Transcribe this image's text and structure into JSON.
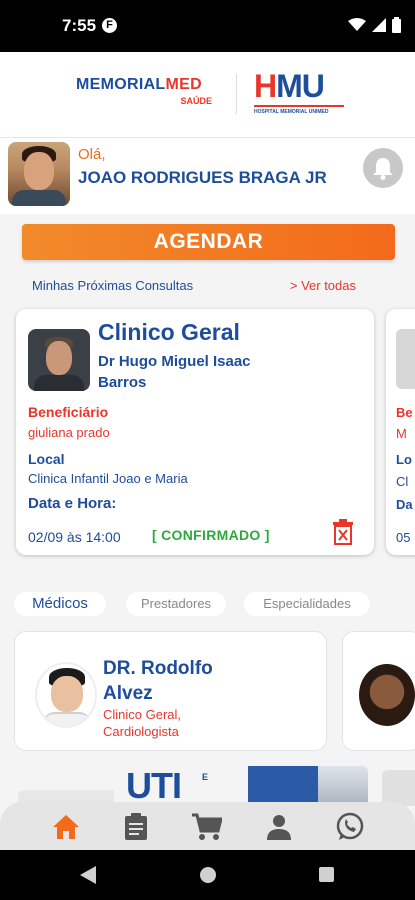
{
  "status_bar": {
    "time": "7:55",
    "notification_glyph": "F",
    "icons": [
      "wifi-icon",
      "signal-icon",
      "battery-icon"
    ]
  },
  "header": {
    "logo_left": {
      "main_part1": "MEMORIAL",
      "main_part2": "MED",
      "sub": "SAÚDE"
    },
    "logo_right": {
      "main_part1": "H",
      "main_part2": "MU",
      "sub": "HOSPITAL MEMORIAL UNIMED"
    }
  },
  "profile": {
    "greeting": "Olá,",
    "name": "JOAO RODRIGUES BRAGA JR",
    "bell_icon": "bell-icon"
  },
  "actions": {
    "schedule_label": "AGENDAR"
  },
  "appointments": {
    "section_title": "Minhas Próximas Consultas",
    "see_all": "> Ver todas",
    "card": {
      "specialty": "Clinico Geral",
      "doctor": "Dr Hugo Miguel Isaac Barros",
      "beneficiary_label": "Beneficiário",
      "beneficiary": "giuliana prado",
      "location_label": "Local",
      "location": "Clinica Infantil Joao e Maria",
      "datetime_label": "Data e Hora:",
      "datetime": "02/09  às  14:00",
      "status": "[ CONFIRMADO ]",
      "delete_icon": "trash-icon"
    },
    "peek_card": {
      "l1": "Be",
      "l2": "M",
      "l3": "Lo",
      "l4": "Cl",
      "l5": "Da",
      "l6": "05"
    }
  },
  "tabs": [
    {
      "label": "Médicos",
      "active": true
    },
    {
      "label": "Prestadores",
      "active": false
    },
    {
      "label": "Especialidades",
      "active": false
    }
  ],
  "doctors": [
    {
      "name": "DR. Rodolfo Alvez",
      "specialties": "Clinico Geral, Cardiologista"
    }
  ],
  "banner": {
    "text": "UTI",
    "small": "E"
  },
  "bottom_nav": [
    {
      "name": "home-icon",
      "active": true
    },
    {
      "name": "clipboard-icon",
      "active": false
    },
    {
      "name": "cart-icon",
      "active": false
    },
    {
      "name": "person-icon",
      "active": false
    },
    {
      "name": "whatsapp-icon",
      "active": false
    }
  ],
  "colors": {
    "brand_blue": "#1e4d9a",
    "brand_orange": "#f26a1b",
    "brand_red": "#e8362b",
    "confirmed_green": "#2eaa3d"
  }
}
